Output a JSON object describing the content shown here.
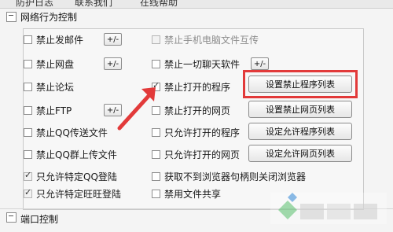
{
  "top_tabs": [
    "防护日志",
    "联系我们",
    "在线帮助"
  ],
  "sections": {
    "network_behavior": "网络行为控制",
    "port_control": "端口控制"
  },
  "buttons": {
    "plus_minus": "+/-",
    "set_block_programs": "设置禁止程序列表",
    "set_block_webpages": "设置禁止网页列表",
    "set_allow_programs": "设定允许程序列表",
    "set_allow_webpages": "设定允许网页列表"
  },
  "checkboxes": {
    "left": [
      {
        "label": "禁止发邮件",
        "checked": false,
        "disabled": false
      },
      {
        "label": "禁止网盘",
        "checked": false,
        "disabled": false
      },
      {
        "label": "禁止论坛",
        "checked": false,
        "disabled": false
      },
      {
        "label": "禁止FTP",
        "checked": false,
        "disabled": false
      },
      {
        "label": "禁止QQ传送文件",
        "checked": false,
        "disabled": false
      },
      {
        "label": "禁止QQ群上传文件",
        "checked": false,
        "disabled": false
      },
      {
        "label": "只允许特定QQ登陆",
        "checked": true,
        "disabled": true
      },
      {
        "label": "只允许特定旺旺登陆",
        "checked": true,
        "disabled": true
      }
    ],
    "right": [
      {
        "label": "禁止手机电脑文件互传",
        "checked": false,
        "disabled": true
      },
      {
        "label": "禁止一切聊天软件",
        "checked": false,
        "disabled": false
      },
      {
        "label": "禁止打开的程序",
        "checked": true,
        "disabled": false
      },
      {
        "label": "禁止打开的网页",
        "checked": false,
        "disabled": false
      },
      {
        "label": "只允许打开的程序",
        "checked": false,
        "disabled": false
      },
      {
        "label": "只允许打开的网页",
        "checked": false,
        "disabled": false
      },
      {
        "label": "获取不到浏览器句柄则关闭浏览器",
        "checked": false,
        "disabled": false
      },
      {
        "label": "禁用文件共享",
        "checked": false,
        "disabled": false
      }
    ]
  },
  "colors": {
    "highlight": "#e23a3a",
    "arrow": "#e23a3a"
  }
}
